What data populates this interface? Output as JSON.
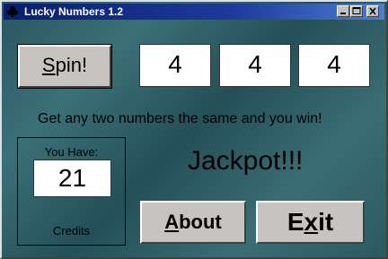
{
  "window": {
    "title": "Lucky Numbers 1.2"
  },
  "buttons": {
    "spin_prefix": "S",
    "spin_rest": "pin!",
    "about_prefix": "A",
    "about_rest": "bout",
    "exit_first": "E",
    "exit_accel": "x",
    "exit_rest": "it"
  },
  "reels": [
    "4",
    "4",
    "4"
  ],
  "rules_text": "Get any two numbers the same and you win!",
  "credits": {
    "heading": "You Have:",
    "value": "21",
    "label": "Credits"
  },
  "result_text": "Jackpot!!!",
  "icons": [
    "app-club-icon",
    "minimize-icon",
    "maximize-icon",
    "close-icon"
  ]
}
